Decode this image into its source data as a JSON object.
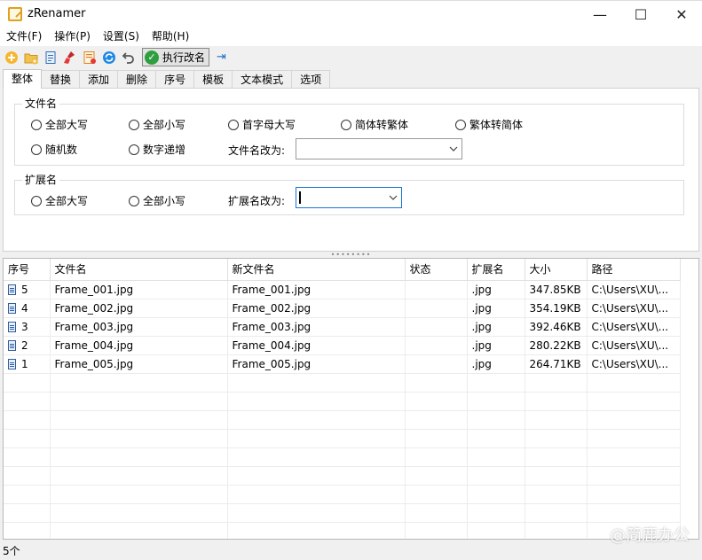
{
  "window": {
    "title": "zRenamer",
    "controls": {
      "minimize": "—",
      "maximize": "☐",
      "close": "✕"
    }
  },
  "menu": [
    "文件(F)",
    "操作(P)",
    "设置(S)",
    "帮助(H)"
  ],
  "toolbar": {
    "icons": [
      "add-file-icon",
      "add-folder-icon",
      "copy-icon",
      "clear-icon",
      "rename-list-icon",
      "refresh-icon",
      "undo-icon"
    ],
    "execute_label": "执行改名",
    "pin_icon": "pin-icon"
  },
  "tabs": [
    "整体",
    "替换",
    "添加",
    "删除",
    "序号",
    "模板",
    "文本模式",
    "选项"
  ],
  "active_tab": "整体",
  "filename_group": {
    "label": "文件名",
    "options_row1": [
      "全部大写",
      "全部小写",
      "首字母大写",
      "简体转繁体",
      "繁体转简体"
    ],
    "options_row2": [
      "随机数",
      "数字递增"
    ],
    "rename_label": "文件名改为:",
    "rename_value": ""
  },
  "extension_group": {
    "label": "扩展名",
    "options": [
      "全部大写",
      "全部小写"
    ],
    "rename_label": "扩展名改为:",
    "rename_value": ""
  },
  "file_table": {
    "columns": [
      "序号",
      "文件名",
      "新文件名",
      "状态",
      "扩展名",
      "大小",
      "路径"
    ],
    "rows": [
      {
        "index": "5",
        "name": "Frame_001.jpg",
        "new_name": "Frame_001.jpg",
        "status": "",
        "ext": ".jpg",
        "size": "347.85KB",
        "path": "C:\\Users\\XU\\..."
      },
      {
        "index": "4",
        "name": "Frame_002.jpg",
        "new_name": "Frame_002.jpg",
        "status": "",
        "ext": ".jpg",
        "size": "354.19KB",
        "path": "C:\\Users\\XU\\..."
      },
      {
        "index": "3",
        "name": "Frame_003.jpg",
        "new_name": "Frame_003.jpg",
        "status": "",
        "ext": ".jpg",
        "size": "392.46KB",
        "path": "C:\\Users\\XU\\..."
      },
      {
        "index": "2",
        "name": "Frame_004.jpg",
        "new_name": "Frame_004.jpg",
        "status": "",
        "ext": ".jpg",
        "size": "280.22KB",
        "path": "C:\\Users\\XU\\..."
      },
      {
        "index": "1",
        "name": "Frame_005.jpg",
        "new_name": "Frame_005.jpg",
        "status": "",
        "ext": ".jpg",
        "size": "264.71KB",
        "path": "C:\\Users\\XU\\..."
      }
    ]
  },
  "status": {
    "count": "5个"
  },
  "watermark": "@简鹿办公",
  "colors": {
    "accent": "#1976d2",
    "execute_green": "#2e9e3e"
  }
}
